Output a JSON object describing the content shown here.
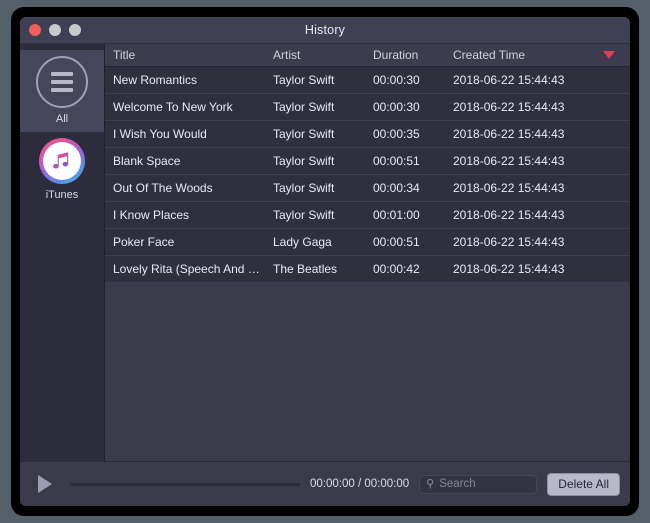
{
  "window": {
    "title": "History",
    "traffic_lights": [
      {
        "name": "close-button",
        "color": "#ec5f5b"
      },
      {
        "name": "minimize-button",
        "color": "#c9c9ce"
      },
      {
        "name": "zoom-button",
        "color": "#c9c9ce"
      }
    ]
  },
  "sidebar": {
    "items": [
      {
        "label": "All",
        "icon": "list-circle-icon",
        "selected": true
      },
      {
        "label": "iTunes",
        "icon": "itunes-icon",
        "selected": false
      }
    ]
  },
  "table": {
    "columns": [
      {
        "key": "title",
        "label": "Title"
      },
      {
        "key": "artist",
        "label": "Artist"
      },
      {
        "key": "duration",
        "label": "Duration"
      },
      {
        "key": "created",
        "label": "Created Time"
      }
    ],
    "sort": {
      "column": "Created Time",
      "direction": "descending",
      "icon": "caret-down-icon",
      "color": "#e03e5f"
    },
    "rows": [
      {
        "title": "New Romantics",
        "artist": "Taylor Swift",
        "duration": "00:00:30",
        "created": "2018-06-22 15:44:43"
      },
      {
        "title": "Welcome To New York",
        "artist": "Taylor Swift",
        "duration": "00:00:30",
        "created": "2018-06-22 15:44:43"
      },
      {
        "title": "I Wish You Would",
        "artist": "Taylor Swift",
        "duration": "00:00:35",
        "created": "2018-06-22 15:44:43"
      },
      {
        "title": "Blank Space",
        "artist": "Taylor Swift",
        "duration": "00:00:51",
        "created": "2018-06-22 15:44:43"
      },
      {
        "title": "Out Of The Woods",
        "artist": "Taylor Swift",
        "duration": "00:00:34",
        "created": "2018-06-22 15:44:43"
      },
      {
        "title": "I Know Places",
        "artist": "Taylor Swift",
        "duration": "00:01:00",
        "created": "2018-06-22 15:44:43"
      },
      {
        "title": "Poker Face",
        "artist": "Lady Gaga",
        "duration": "00:00:51",
        "created": "2018-06-22 15:44:43"
      },
      {
        "title": "Lovely Rita (Speech And …",
        "artist": "The Beatles",
        "duration": "00:00:42",
        "created": "2018-06-22 15:44:43"
      }
    ]
  },
  "player": {
    "play_icon": "play-icon",
    "progress_percent": 0,
    "time": "00:00:00 / 00:00:00"
  },
  "search": {
    "icon": "search-icon",
    "placeholder": "Search",
    "value": ""
  },
  "actions": {
    "delete_all_label": "Delete All"
  }
}
